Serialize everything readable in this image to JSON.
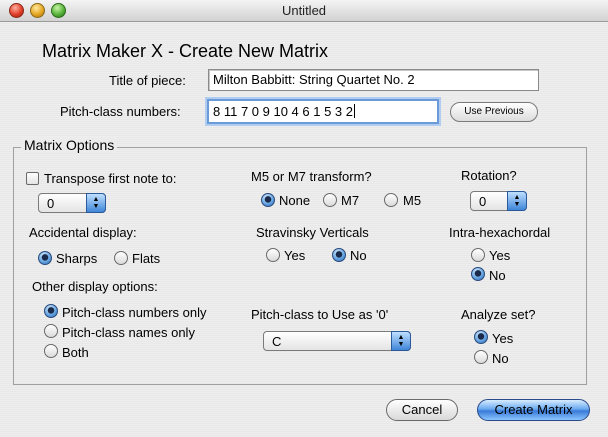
{
  "window": {
    "title": "Untitled"
  },
  "heading": "Matrix Maker X - Create New Matrix",
  "title_of_piece": {
    "label": "Title of piece:",
    "value": "Milton Babbitt: String Quartet No. 2"
  },
  "pitch_class_numbers": {
    "label": "Pitch-class numbers:",
    "value": "8 11 7 0 9 10 4 6 1 5 3 2"
  },
  "use_previous_label": "Use Previous",
  "options": {
    "legend": "Matrix Options",
    "transpose": {
      "label": "Transpose first note to:",
      "checked": false,
      "value": "0"
    },
    "m5m7": {
      "label": "M5 or M7 transform?",
      "options": [
        "None",
        "M7",
        "M5"
      ],
      "selected": "None"
    },
    "rotation": {
      "label": "Rotation?",
      "value": "0"
    },
    "accidental": {
      "label": "Accidental display:",
      "options": [
        "Sharps",
        "Flats"
      ],
      "selected": "Sharps"
    },
    "stravinsky": {
      "label": "Stravinsky Verticals",
      "options": [
        "Yes",
        "No"
      ],
      "selected": "No"
    },
    "intra": {
      "label": "Intra-hexachordal",
      "options": [
        "Yes",
        "No"
      ],
      "selected": "No"
    },
    "other_display": {
      "label": "Other display options:",
      "options": [
        "Pitch-class numbers only",
        "Pitch-class names only",
        "Both"
      ],
      "selected": "Pitch-class numbers only"
    },
    "pc_zero": {
      "label": "Pitch-class to Use as '0'",
      "value": "C"
    },
    "analyze": {
      "label": "Analyze set?",
      "options": [
        "Yes",
        "No"
      ],
      "selected": "Yes"
    }
  },
  "buttons": {
    "cancel": "Cancel",
    "create": "Create Matrix"
  }
}
